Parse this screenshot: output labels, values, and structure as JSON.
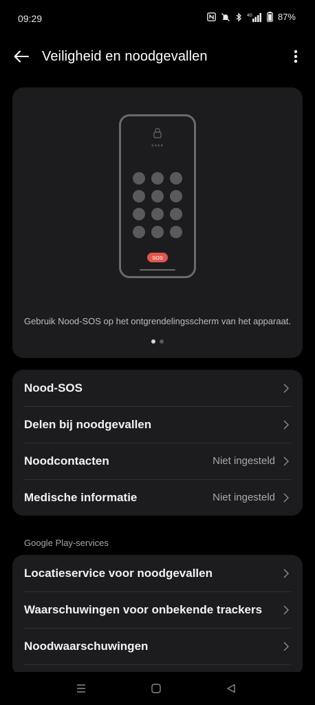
{
  "status_bar": {
    "time": "09:29",
    "battery": "87%",
    "network": "4G"
  },
  "app_bar": {
    "title": "Veiligheid en noodgevallen",
    "back_icon": "arrow-left-icon",
    "more_icon": "more-vert-icon"
  },
  "hero": {
    "lock_hint": "****",
    "sos_label": "SOS",
    "caption": "Gebruik Nood-SOS op het ontgrendelingsscherm van het apparaat.",
    "page_count": 2,
    "active_page": 1,
    "sos_color": "#e0574f"
  },
  "main_list": {
    "items": [
      {
        "label": "Nood-SOS",
        "value": ""
      },
      {
        "label": "Delen bij noodgevallen",
        "value": ""
      },
      {
        "label": "Noodcontacten",
        "value": "Niet ingesteld"
      },
      {
        "label": "Medische informatie",
        "value": "Niet ingesteld"
      }
    ]
  },
  "google_section": {
    "header": "Google Play-services",
    "items": [
      {
        "label": "Locatieservice voor noodgevallen"
      },
      {
        "label": "Waarschuwingen voor onbekende trackers"
      },
      {
        "label": "Noodwaarschuwingen"
      }
    ]
  },
  "colors": {
    "background": "#000000",
    "card": "#1c1c1e",
    "sos": "#e0574f"
  }
}
